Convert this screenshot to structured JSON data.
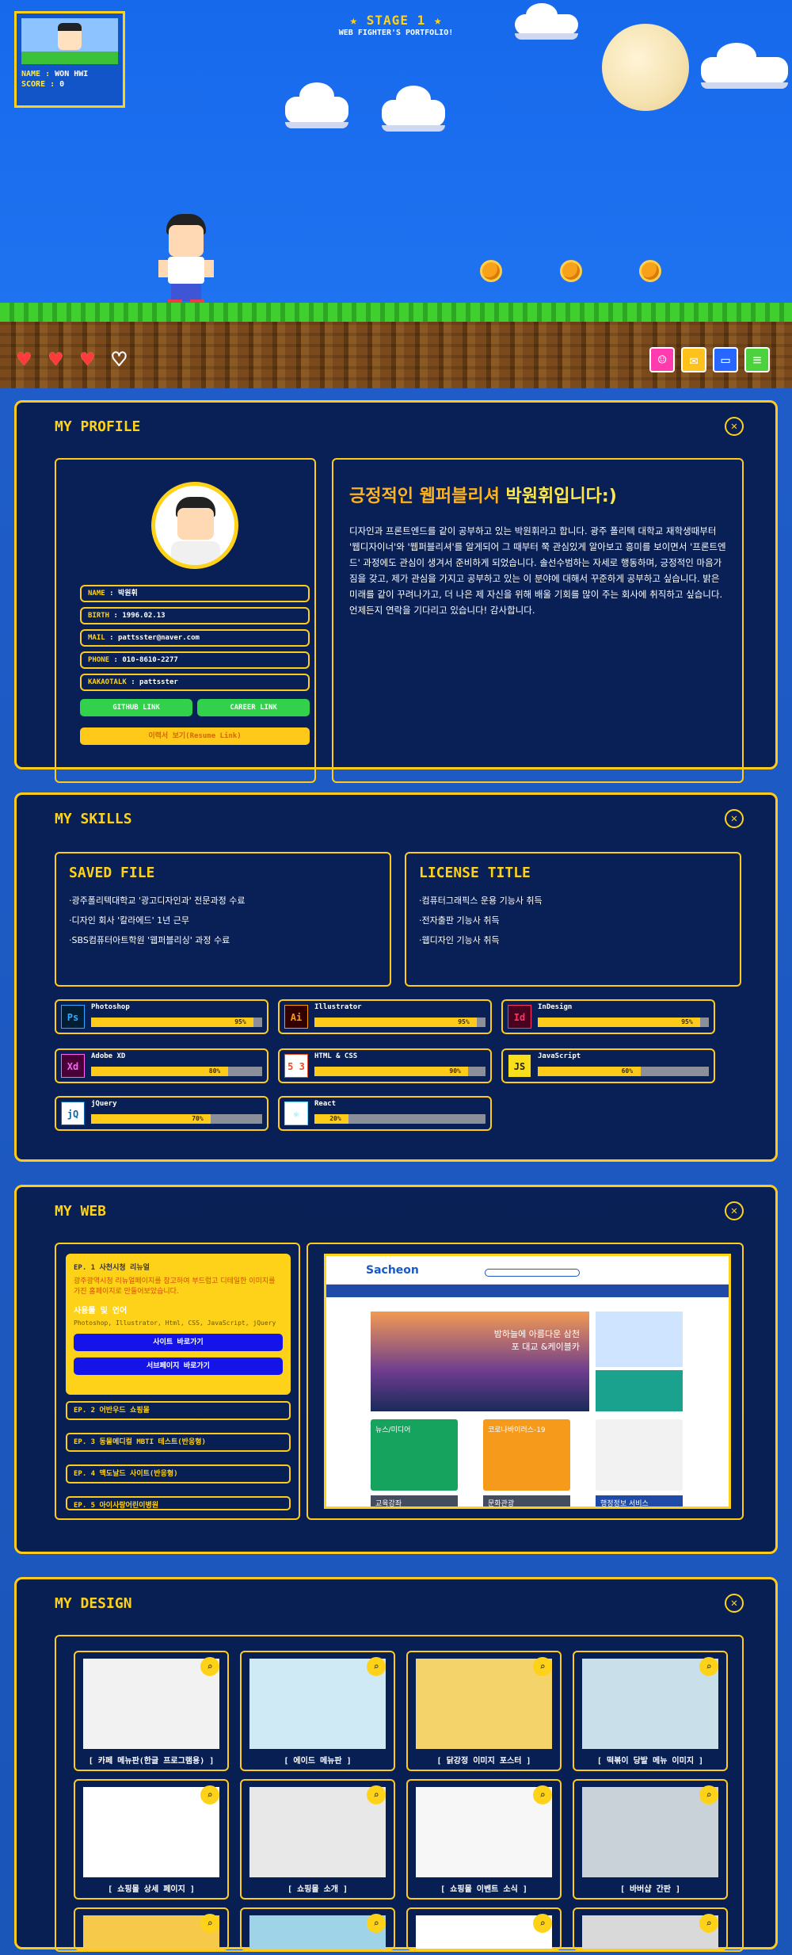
{
  "hero": {
    "stage": "★ STAGE 1 ★",
    "subtitle": "WEB FIGHTER'S PORTFOLIO!",
    "name_label": "NAME : ",
    "name_value": "WON HWI",
    "score_label": "SCORE : ",
    "score_value": "0",
    "hearts": [
      true,
      true,
      true,
      false
    ]
  },
  "profile": {
    "title": "MY PROFILE",
    "headline_a": "긍정적인 웹퍼블리셔 ",
    "headline_b": "박원휘입니다:)",
    "intro": "디자인과 프론트엔드를 같이 공부하고 있는 박원휘라고 합니다. 광주 폴리텍 대학교 재학생때부터 '웹디자이너'와 '웹퍼블리셔'를 알게되어 그 때부터 쭉 관심있게 알아보고 흥미를 보이면서 '프론트엔드' 과정에도 관심이 생겨서 준비하게 되었습니다. 솔선수범하는 자세로 행동하며, 긍정적인 마음가짐을 갖고, 제가 관심을 가지고 공부하고 있는 이 분야에 대해서 꾸준하게 공부하고 싶습니다. 밝은 미래를 같이 꾸려나가고, 더 나은 제 자신을 위해 배울 기회를 많이 주는 회사에 취직하고 싶습니다. 언제든지 연락을 기다리고 있습니다! 감사합니다.",
    "rows": [
      {
        "label": "NAME",
        "value": "박원휘"
      },
      {
        "label": "BIRTH",
        "value": "1996.02.13"
      },
      {
        "label": "MAIL",
        "value": "pattsster@naver.com"
      },
      {
        "label": "PHONE",
        "value": "010-8610-2277"
      },
      {
        "label": "KAKAOTALK",
        "value": "pattsster"
      }
    ],
    "github_label": "GITHUB LINK",
    "career_label": "CAREER LINK",
    "resume_label": "이력서 보기(Resume Link)"
  },
  "skills": {
    "title": "MY SKILLS",
    "saved_title": "SAVED FILE",
    "saved": [
      "·광주폴리텍대학교 '광고디자인과' 전문과정 수료",
      "·디자인 회사 '칼라에드' 1년 근무",
      "·SBS컴퓨터아트학원 '웹퍼블리싱' 과정 수료"
    ],
    "license_title": "LICENSE TITLE",
    "licenses": [
      "·컴퓨터그래픽스 운용 기능사 취득",
      "·전자출판 기능사 취득",
      "·웹디자인 기능사 취득"
    ],
    "items": [
      {
        "name": "Photoshop",
        "icon": "Ps",
        "value": 95,
        "label": "95%",
        "bg": "#001e36",
        "fg": "#31a8ff"
      },
      {
        "name": "Illustrator",
        "icon": "Ai",
        "value": 95,
        "label": "95%",
        "bg": "#330000",
        "fg": "#ff9a00"
      },
      {
        "name": "InDesign",
        "icon": "Id",
        "value": 95,
        "label": "95%",
        "bg": "#49021f",
        "fg": "#ff3366"
      },
      {
        "name": "Adobe XD",
        "icon": "Xd",
        "value": 80,
        "label": "80%",
        "bg": "#470137",
        "fg": "#ff61f6"
      },
      {
        "name": "HTML & CSS",
        "icon": "5 3",
        "value": 90,
        "label": "90%",
        "bg": "#ffffff",
        "fg": "#e44d26"
      },
      {
        "name": "JavaScript",
        "icon": "JS",
        "value": 60,
        "label": "60%",
        "bg": "#f7df1e",
        "fg": "#222222"
      },
      {
        "name": "jQuery",
        "icon": "jQ",
        "value": 70,
        "label": "70%",
        "bg": "#ffffff",
        "fg": "#0769ad"
      },
      {
        "name": "React",
        "icon": "⚛",
        "value": 20,
        "label": "20%",
        "bg": "#ffffff",
        "fg": "#61dafb"
      }
    ]
  },
  "web": {
    "title": "MY WEB",
    "ep1_title": "EP. 1 사천시청 리뉴얼",
    "ep1_desc": "광주광역시청 리뉴얼페이지를 참고하여 부드럽고 디테일한 이미지를 가진 홈페이지로 만들어보았습니다.",
    "ep1_tech_title": "사용툴 및 언어",
    "ep1_tech": "Photoshop, Illustrator, Html, CSS, JavaScript, jQuery",
    "btn_site": "사이트 바로가기",
    "btn_sub": "서브페이지 바로가기",
    "episodes": [
      "EP. 2 어반우드 쇼핑몰",
      "EP. 3 동물메디컬 MBTI 테스트(반응형)",
      "EP. 4 맥도날드 사이트(반응형)",
      "EP. 5 아이사랑어린이병원"
    ],
    "site_logo": "Sacheon",
    "site_banner": "밤하늘에 아름다운 삼천포 대교 &케이블카",
    "site_sections": [
      "뉴스/미디어",
      "코로나바이러스-19",
      "교육강좌",
      "문화관광",
      "행정정보 서비스"
    ]
  },
  "design": {
    "title": "MY DESIGN",
    "items": [
      "[ 카페 메뉴판(한글 프로그램용) ]",
      "[ 에이드 메뉴판 ]",
      "[ 닭강정 이미지 포스터 ]",
      "[ 떡볶이 당발 메뉴 이미지 ]",
      "[ 쇼핑몰 상세 페이지 ]",
      "[ 쇼핑몰 소개 ]",
      "[ 쇼핑몰 이벤트 소식 ]",
      "[ 바버샵 간판 ]"
    ]
  },
  "icons": {
    "close": "close-icon",
    "zoom": "search-icon",
    "person": "person-icon",
    "mail": "mail-icon",
    "pc": "computer-icon",
    "doc": "document-icon",
    "heart": "heart-icon"
  }
}
